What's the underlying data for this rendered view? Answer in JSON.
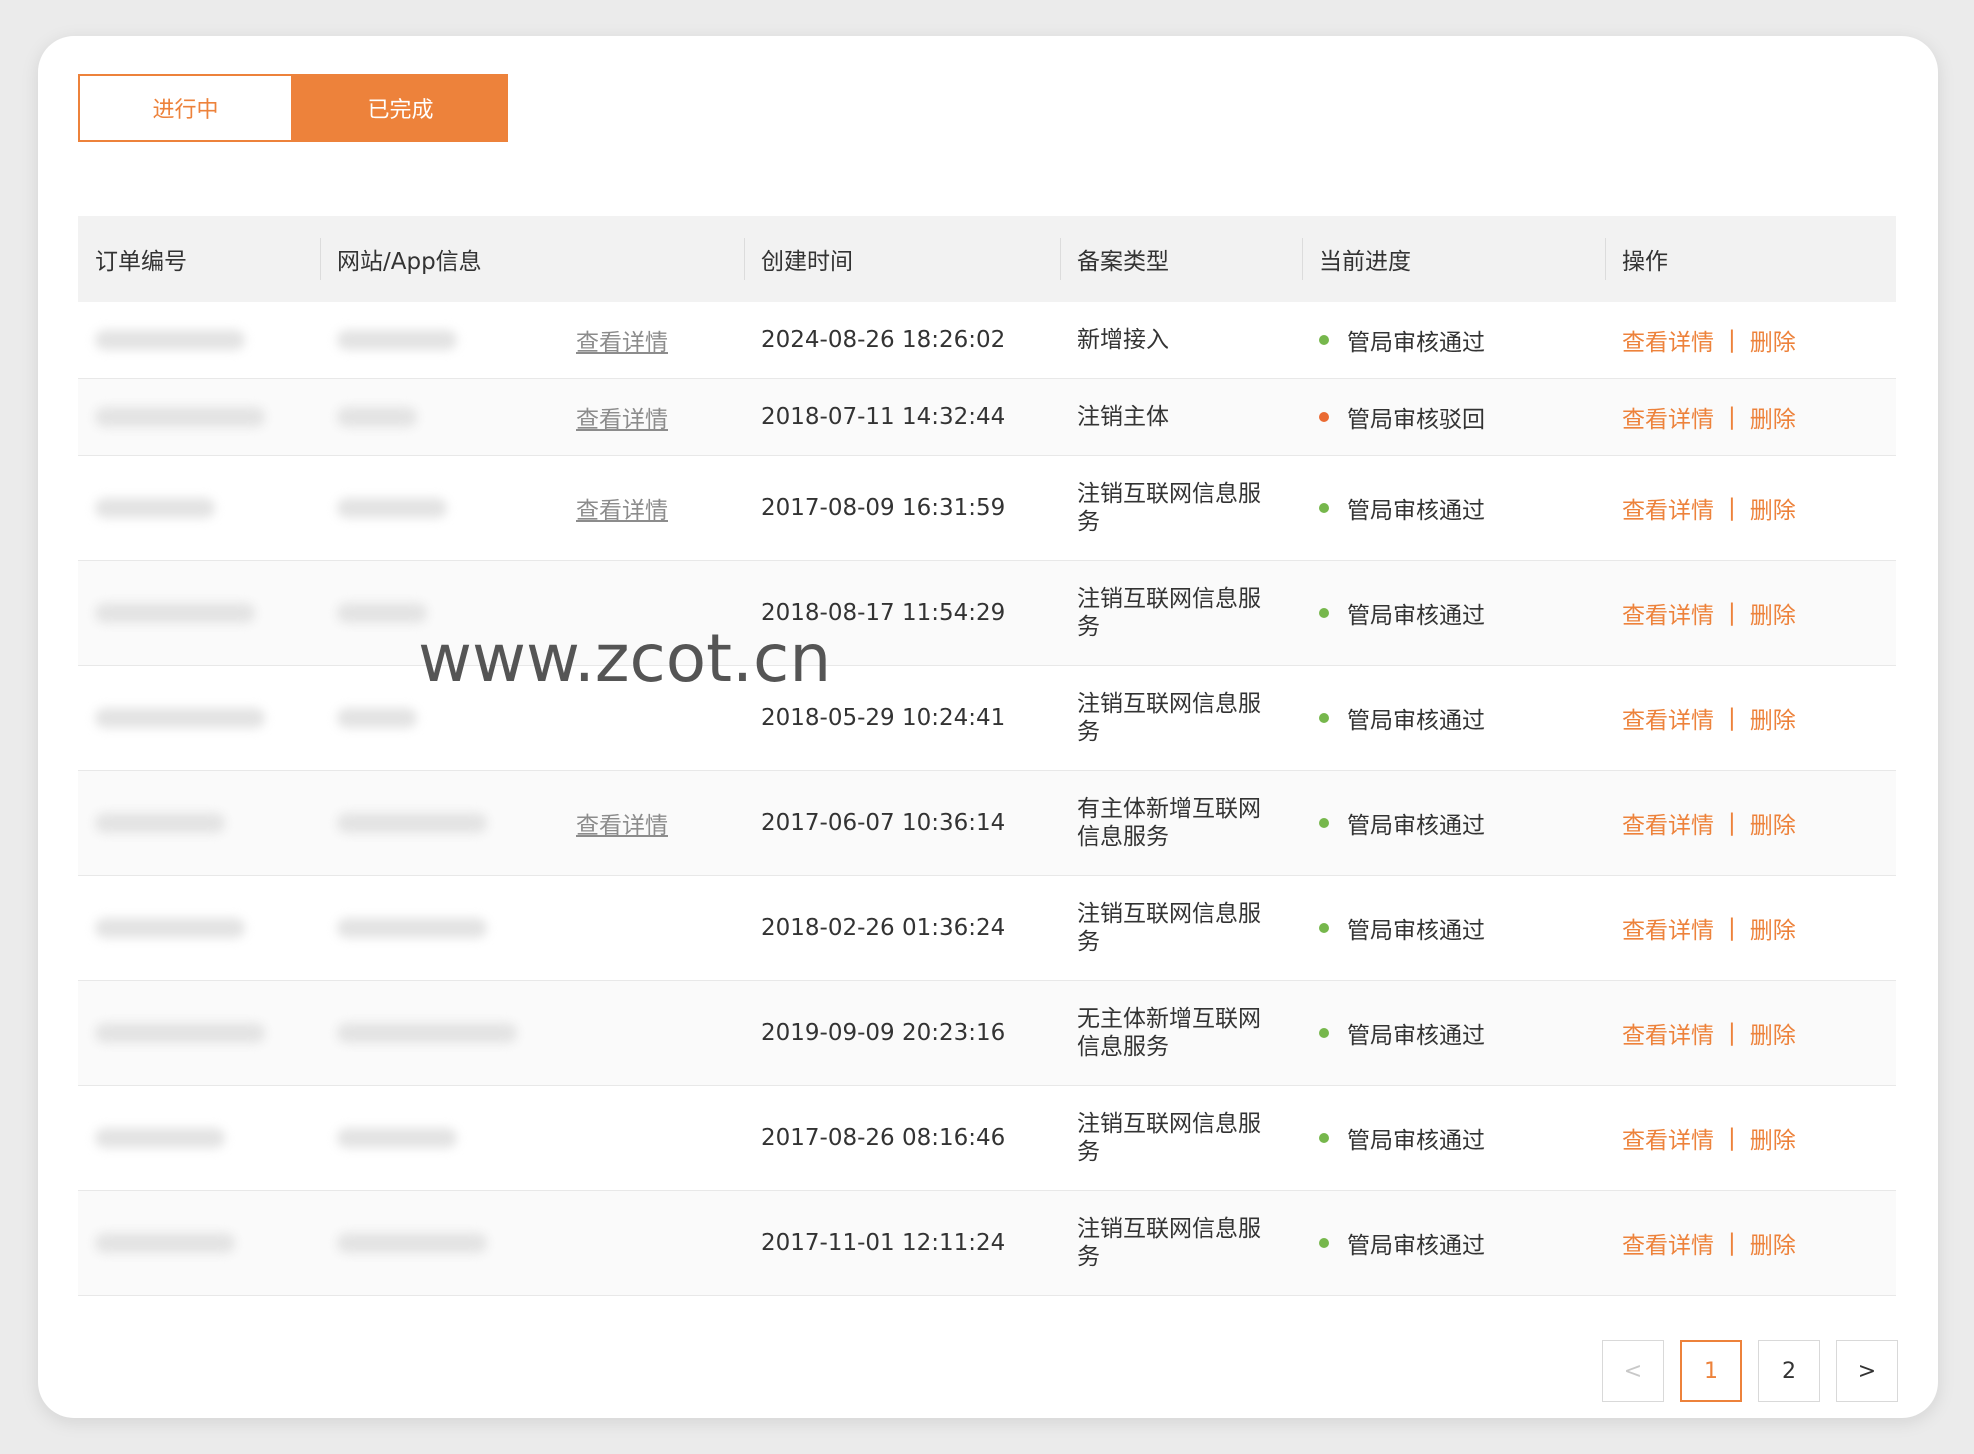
{
  "tabs": [
    {
      "label": "进行中",
      "active": false
    },
    {
      "label": "已完成",
      "active": true
    }
  ],
  "columns": [
    "订单编号",
    "网站/App信息",
    "创建时间",
    "备案类型",
    "当前进度",
    "操作"
  ],
  "rows": [
    {
      "detail_link": "查看详情",
      "created": "2024-08-26 18:26:02",
      "type": "新增接入",
      "status": "管局审核通过",
      "status_kind": "ok",
      "view": "查看详情",
      "del": "删除"
    },
    {
      "detail_link": "查看详情",
      "created": "2018-07-11 14:32:44",
      "type": "注销主体",
      "status": "管局审核驳回",
      "status_kind": "bad",
      "view": "查看详情",
      "del": "删除"
    },
    {
      "detail_link": "查看详情",
      "created": "2017-08-09 16:31:59",
      "type": "注销互联网信息服务",
      "status": "管局审核通过",
      "status_kind": "ok",
      "view": "查看详情",
      "del": "删除"
    },
    {
      "detail_link": "",
      "created": "2018-08-17 11:54:29",
      "type": "注销互联网信息服务",
      "status": "管局审核通过",
      "status_kind": "ok",
      "view": "查看详情",
      "del": "删除"
    },
    {
      "detail_link": "",
      "created": "2018-05-29 10:24:41",
      "type": "注销互联网信息服务",
      "status": "管局审核通过",
      "status_kind": "ok",
      "view": "查看详情",
      "del": "删除"
    },
    {
      "detail_link": "查看详情",
      "created": "2017-06-07 10:36:14",
      "type": "有主体新增互联网信息服务",
      "status": "管局审核通过",
      "status_kind": "ok",
      "view": "查看详情",
      "del": "删除"
    },
    {
      "detail_link": "",
      "created": "2018-02-26 01:36:24",
      "type": "注销互联网信息服务",
      "status": "管局审核通过",
      "status_kind": "ok",
      "view": "查看详情",
      "del": "删除"
    },
    {
      "detail_link": "",
      "created": "2019-09-09 20:23:16",
      "type": "无主体新增互联网信息服务",
      "status": "管局审核通过",
      "status_kind": "ok",
      "view": "查看详情",
      "del": "删除"
    },
    {
      "detail_link": "",
      "created": "2017-08-26 08:16:46",
      "type": "注销互联网信息服务",
      "status": "管局审核通过",
      "status_kind": "ok",
      "view": "查看详情",
      "del": "删除"
    },
    {
      "detail_link": "",
      "created": "2017-11-01 12:11:24",
      "type": "注销互联网信息服务",
      "status": "管局审核通过",
      "status_kind": "ok",
      "view": "查看详情",
      "del": "删除"
    }
  ],
  "separator": "|",
  "pagination": {
    "prev": "<",
    "pages": [
      "1",
      "2"
    ],
    "current": "1",
    "next": ">"
  },
  "watermark": "www.zcot.cn",
  "colors": {
    "accent": "#ed823b",
    "ok": "#76b74c",
    "bad": "#ea6a32"
  }
}
